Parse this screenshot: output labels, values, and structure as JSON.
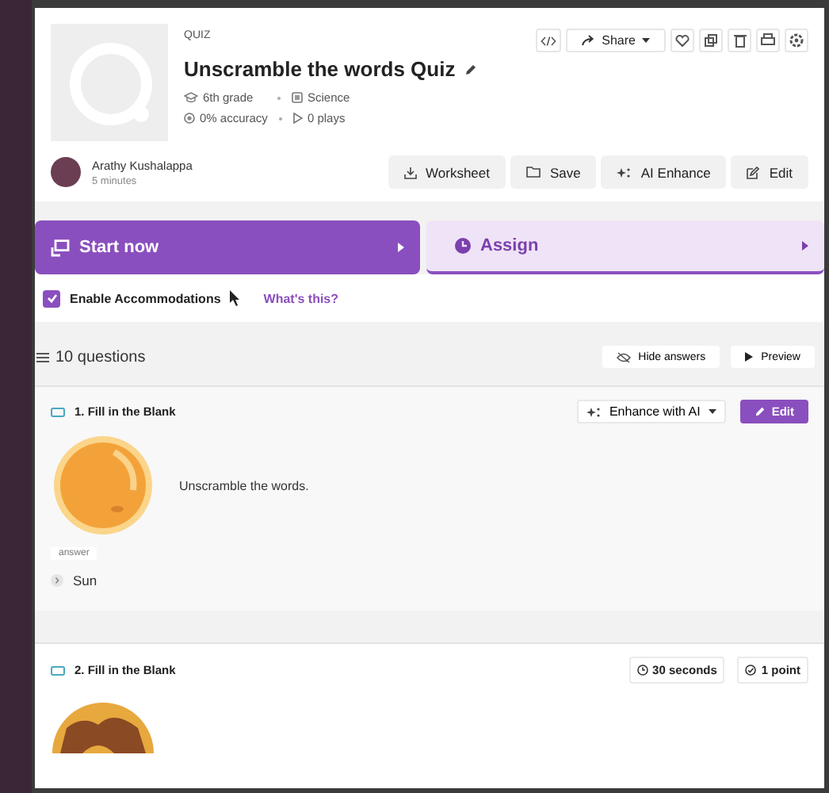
{
  "quiz": {
    "type_label": "QUIZ",
    "title": "Unscramble the words Quiz",
    "grade": "6th grade",
    "subject": "Science",
    "accuracy": "0% accuracy",
    "plays": "0 plays"
  },
  "toolbar": {
    "share": "Share"
  },
  "author": {
    "name": "Arathy Kushalappa",
    "time": "5 minutes"
  },
  "actions": [
    "Worksheet",
    "Save",
    "AI Enhance",
    "Edit"
  ],
  "start": {
    "label": "Start now"
  },
  "assign": {
    "label": "Assign"
  },
  "accommodations": {
    "label": "Enable Accommodations",
    "checked": true,
    "link": "What's this?"
  },
  "questions_header": {
    "count": "10 questions",
    "hide": "Hide answers",
    "preview": "Preview"
  },
  "questions": [
    {
      "kind": "expanded",
      "title": "1. Fill in the Blank",
      "enhance": "Enhance with AI",
      "edit": "Edit",
      "text": "Unscramble the words.",
      "answer_label": "answer",
      "answer": "Sun"
    },
    {
      "kind": "collapsed",
      "title": "2. Fill in the Blank",
      "time": "30 seconds",
      "points": "1 point"
    }
  ]
}
